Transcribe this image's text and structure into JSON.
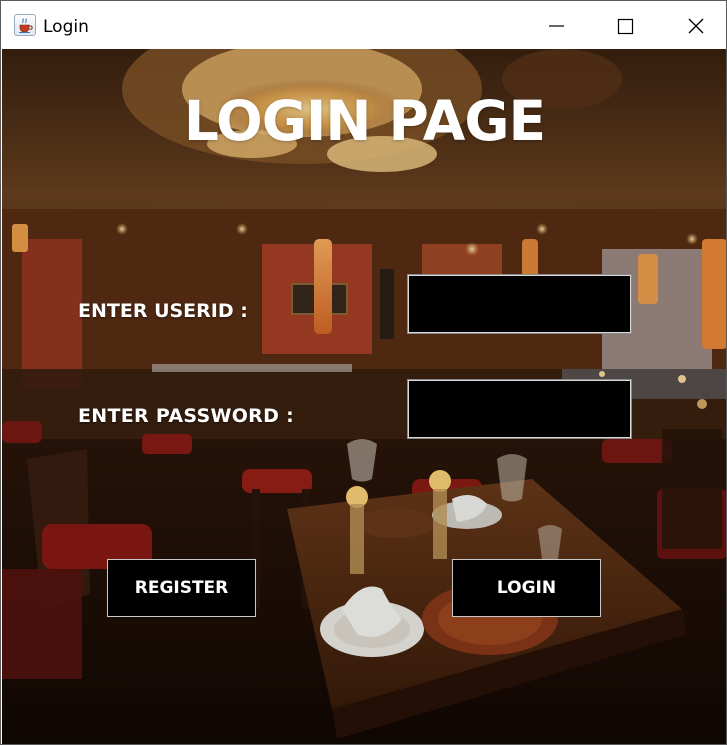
{
  "window": {
    "title": "Login",
    "app_icon": "java-cup-icon",
    "controls": {
      "minimize_icon": "minimize-icon",
      "maximize_icon": "maximize-icon",
      "close_icon": "close-icon"
    }
  },
  "form": {
    "heading": "LOGIN PAGE",
    "userid_label": "ENTER USERID :",
    "password_label": "ENTER PASSWORD :",
    "userid_value": "",
    "password_value": "",
    "register_label": "REGISTER",
    "login_label": "LOGIN"
  },
  "colors": {
    "input_background": "#000000",
    "button_background": "#000000",
    "text": "#ffffff"
  }
}
